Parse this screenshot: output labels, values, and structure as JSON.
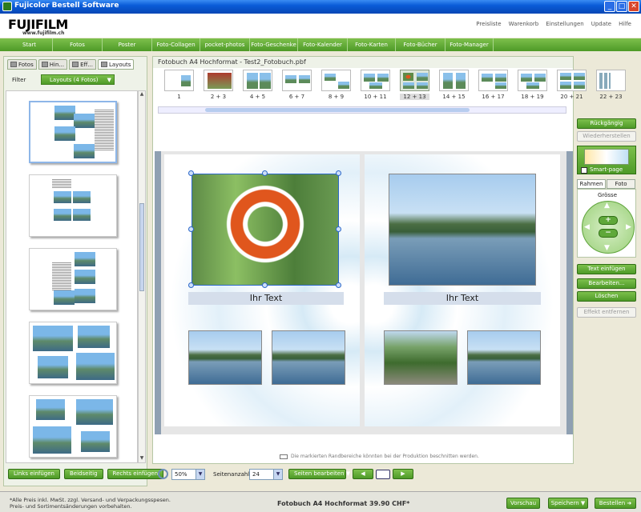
{
  "window": {
    "title": "Fujicolor Bestell Software",
    "btn_min": "_",
    "btn_max": "□",
    "btn_close": "✕"
  },
  "header": {
    "logo": "FUJIFILM",
    "logo_url": "www.fujifilm.ch",
    "links": [
      "Preisliste",
      "Warenkorb",
      "Einstellungen",
      "Update",
      "Hilfe"
    ]
  },
  "nav": [
    "Start",
    "Fotos",
    "Poster",
    "Foto-Collagen",
    "pocket-photos",
    "Foto-Geschenke",
    "Foto-Kalender",
    "Foto-Karten",
    "Foto-Bücher",
    "Foto-Manager"
  ],
  "left": {
    "tabs": [
      "Fotos",
      "Hin...",
      "Eff...",
      "Layouts"
    ],
    "filter_label": "Filter",
    "filter_value": "Layouts (4 Fotos)",
    "buttons": [
      "Links einfügen",
      "Beidseitig",
      "Rechts einfügen"
    ]
  },
  "center": {
    "doc_title": "Fotobuch A4 Hochformat - Test2_Fotobuch.pbf",
    "spreads": [
      "1",
      "2 + 3",
      "4 + 5",
      "6 + 7",
      "8 + 9",
      "10 + 11",
      "12 + 13",
      "14 + 15",
      "16 + 17",
      "18 + 19",
      "20 + 21",
      "22 + 23"
    ],
    "active_spread": "12 + 13",
    "caption_left": "Ihr Text",
    "caption_right": "Ihr Text",
    "hint": "Die markierten Randbereiche könnten bei der Produktion beschnitten werden.",
    "zoom": "50%",
    "pages_label": "Seitenanzahl",
    "pages_value": "24",
    "edit_pages": "Seiten bearbeiten",
    "prev": "◀",
    "next": "▶"
  },
  "right": {
    "undo": "Rückgängig",
    "redo": "Wiederherstellen",
    "smart_page": "Smart-page",
    "tabs": [
      "Rahmen",
      "Foto"
    ],
    "size_label": "Grösse",
    "insert_text": "Text einfügen",
    "edit": "Bearbeiten...",
    "delete": "Löschen",
    "remove_effect": "Effekt entfernen"
  },
  "footer": {
    "note_line1": "*Alle Preis inkl. MwSt. zzgl. Versand- und Verpackungsspesen.",
    "note_line2": "Preis- und Sortimentsänderungen vorbehalten.",
    "price": "Fotobuch A4 Hochformat 39.90 CHF*",
    "preview": "Vorschau",
    "save": "Speichern",
    "order": "Bestellen"
  },
  "colors": {
    "accent_green": "#4E9A27",
    "title_blue": "#0A5CD8"
  }
}
